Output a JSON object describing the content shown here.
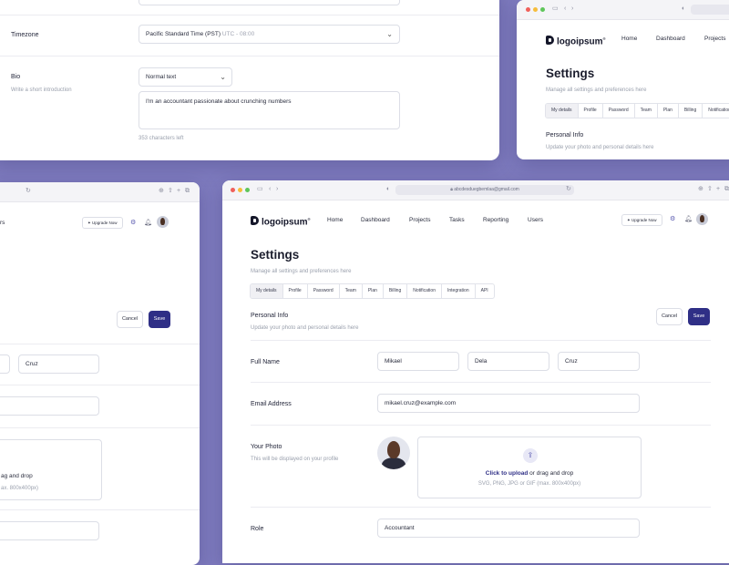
{
  "colors": {
    "background": "#7f7cc0",
    "accent": "#2f2f86",
    "border": "#dcdee6"
  },
  "icons": {
    "theme": "half-circle-icon",
    "tabs": "tabs-icon",
    "back": "chevron-left-icon",
    "forward": "chevron-right-icon",
    "lock": "lock-icon",
    "reload": "reload-icon",
    "download": "download-icon",
    "share": "share-icon",
    "new_tab": "plus-icon",
    "copy": "copy-icon",
    "sparkle": "sparkle-icon",
    "settings": "gear-icon",
    "bell": "bell-icon",
    "upload": "cloud-upload-icon",
    "dropdown": "chevron-down-icon"
  },
  "back_window": {
    "timezone": {
      "label": "Timezone",
      "value": "Pacific Standard Time (PST)",
      "offset": "UTC - 08:00"
    },
    "bio": {
      "label": "Bio",
      "hint": "Write a short introduction",
      "format": "Normal text",
      "text": "I'm an accountant passionate about crunching numbers",
      "counter": "353 characters left"
    }
  },
  "right_window": {
    "logo": "logoipsum",
    "nav": [
      "Home",
      "Dashboard",
      "Projects"
    ],
    "title": "Settings",
    "subtitle": "Manage all settings and preferences here",
    "tabs": [
      "My details",
      "Profile",
      "Password",
      "Team",
      "Plan",
      "Billing",
      "Notification"
    ],
    "section_title": "Personal Info",
    "section_subtitle": "Update your photo and personal details here"
  },
  "left_window": {
    "title_fragment": "rs",
    "upgrade": "Upgrade Now",
    "cancel": "Cancel",
    "save": "Save",
    "last_name": "Cruz",
    "upload_line1": "ag and drop",
    "upload_line2": "ax. 800x400px)"
  },
  "main": {
    "url": "abcdesduegbemlaa@gmail.com",
    "logo": "logoipsum",
    "nav": [
      "Home",
      "Dashboard",
      "Projects",
      "Tasks",
      "Reporting",
      "Users"
    ],
    "upgrade": "Upgrade Now",
    "title": "Settings",
    "subtitle": "Manage all settings and preferences here",
    "tabs": [
      "My details",
      "Profile",
      "Password",
      "Team",
      "Plan",
      "Billing",
      "Notification",
      "Integration",
      "API"
    ],
    "active_tab": "My details",
    "section_title": "Personal Info",
    "section_subtitle": "Update your photo and personal details here",
    "cancel": "Cancel",
    "save": "Save",
    "full_name": {
      "label": "Full Name",
      "first": "Mikael",
      "middle": "Dela",
      "last": "Cruz"
    },
    "email": {
      "label": "Email Address",
      "value": "mikael.cruz@example.com"
    },
    "photo": {
      "label": "Your Photo",
      "hint": "This will be displayed on your profile",
      "upload_link": "Click to upload",
      "upload_rest": "or drag and drop",
      "upload_formats": "SVG, PNG, JPG or GIF (max. 800x400px)"
    },
    "role": {
      "label": "Role",
      "value": "Accountant"
    }
  }
}
